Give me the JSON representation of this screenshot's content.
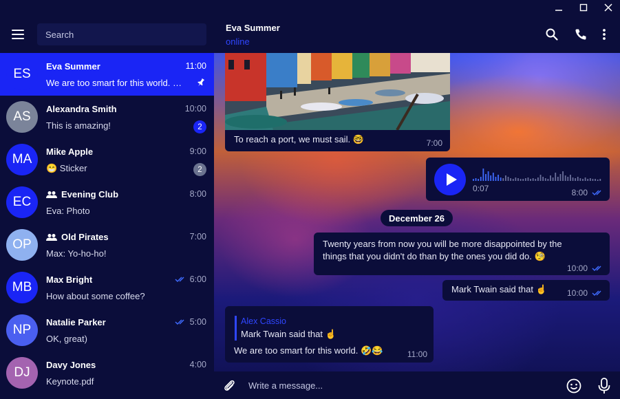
{
  "sidebar": {
    "search_placeholder": "Search",
    "chats": [
      {
        "initials": "ES",
        "name": "Eva Summer",
        "time": "11:00",
        "preview": "We are too smart for this world. 🤣😂",
        "avatar_color": "#1a25f5",
        "pinned": true,
        "group": false,
        "ticks": false,
        "badge": ""
      },
      {
        "initials": "AS",
        "name": "Alexandra Smith",
        "time": "10:00",
        "preview": "This is amazing!",
        "avatar_color": "#7b849a",
        "pinned": false,
        "group": false,
        "ticks": false,
        "badge": "2",
        "badge_color": "#1a25f5"
      },
      {
        "initials": "MA",
        "name": "Mike Apple",
        "time": "9:00",
        "preview": "😁 Sticker",
        "avatar_color": "#1a25f5",
        "pinned": false,
        "group": false,
        "ticks": false,
        "badge": "2",
        "badge_color": "#6b7390"
      },
      {
        "initials": "EC",
        "name": "Evening Club",
        "time": "8:00",
        "preview": "Eva: Photo",
        "avatar_color": "#1a25f5",
        "pinned": false,
        "group": true,
        "ticks": false,
        "badge": ""
      },
      {
        "initials": "OP",
        "name": "Old Pirates",
        "time": "7:00",
        "preview": "Max: Yo-ho-ho!",
        "avatar_color": "#8fb1f0",
        "pinned": false,
        "group": true,
        "ticks": false,
        "badge": ""
      },
      {
        "initials": "MB",
        "name": "Max Bright",
        "time": "6:00",
        "preview": "How about some coffee?",
        "avatar_color": "#1a25f5",
        "pinned": false,
        "group": false,
        "ticks": true,
        "badge": ""
      },
      {
        "initials": "NP",
        "name": "Natalie Parker",
        "time": "5:00",
        "preview": "OK, great)",
        "avatar_color": "#4a5ff0",
        "pinned": false,
        "group": false,
        "ticks": true,
        "badge": ""
      },
      {
        "initials": "DJ",
        "name": "Davy Jones",
        "time": "4:00",
        "preview": "Keynote.pdf",
        "avatar_color": "#a463b0",
        "pinned": false,
        "group": false,
        "ticks": false,
        "badge": ""
      }
    ]
  },
  "header": {
    "name": "Eva Summer",
    "status": "online"
  },
  "messages": {
    "photo_caption": "To reach a port, we must sail. 🤓",
    "photo_time": "7:00",
    "voice_duration": "0:07",
    "voice_time": "8:00",
    "date_divider": "December 26",
    "quote_text": "Twenty years from now you will be more disappointed by the things that you didn't do than by the ones you did do. 🧐",
    "quote_time": "10:00",
    "twain_text": "Mark Twain said that ☝",
    "twain_time": "10:00",
    "reply_author": "Alex Cassio",
    "reply_quoted": "Mark Twain said that ☝",
    "reply_text": "We are too smart for this world. 🤣😂",
    "reply_time": "11:00"
  },
  "composer": {
    "placeholder": "Write a message..."
  },
  "colors": {
    "accent": "#1a25f5",
    "panel": "#0b0d3a",
    "read_ticks": "#3f6bff"
  },
  "icons": [
    "menu-icon",
    "search-icon",
    "phone-icon",
    "more-icon",
    "attach-icon",
    "emoji-icon",
    "mic-icon",
    "pin-icon",
    "group-icon",
    "double-check-icon",
    "play-icon"
  ]
}
